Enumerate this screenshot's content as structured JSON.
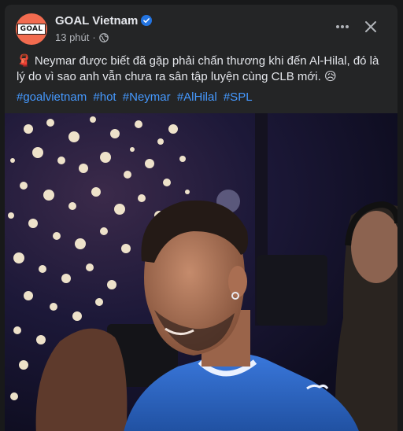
{
  "post": {
    "page_name": "GOAL Vietnam",
    "avatar_text": "GOAL",
    "time": "13 phút",
    "separator": "·",
    "text_emoji": "🧣",
    "text": "Neymar được biết đã gặp phải chấn thương khi đến Al-Hilal, đó là lý do vì sao anh vẫn chưa ra sân tập luyện cùng CLB mới.",
    "text_end_emoji": "😥",
    "hashtags": [
      "#goalvietnam",
      "#hot",
      "#Neymar",
      "#AlHilal",
      "#SPL"
    ]
  },
  "colors": {
    "card_bg": "#242526",
    "avatar_bg": "#f26b4f",
    "link": "#4599ff",
    "verified": "#2374e1",
    "jersey": "#2e66c8"
  },
  "icons": [
    "verified-badge-icon",
    "globe-icon",
    "more-options-icon",
    "close-icon"
  ]
}
